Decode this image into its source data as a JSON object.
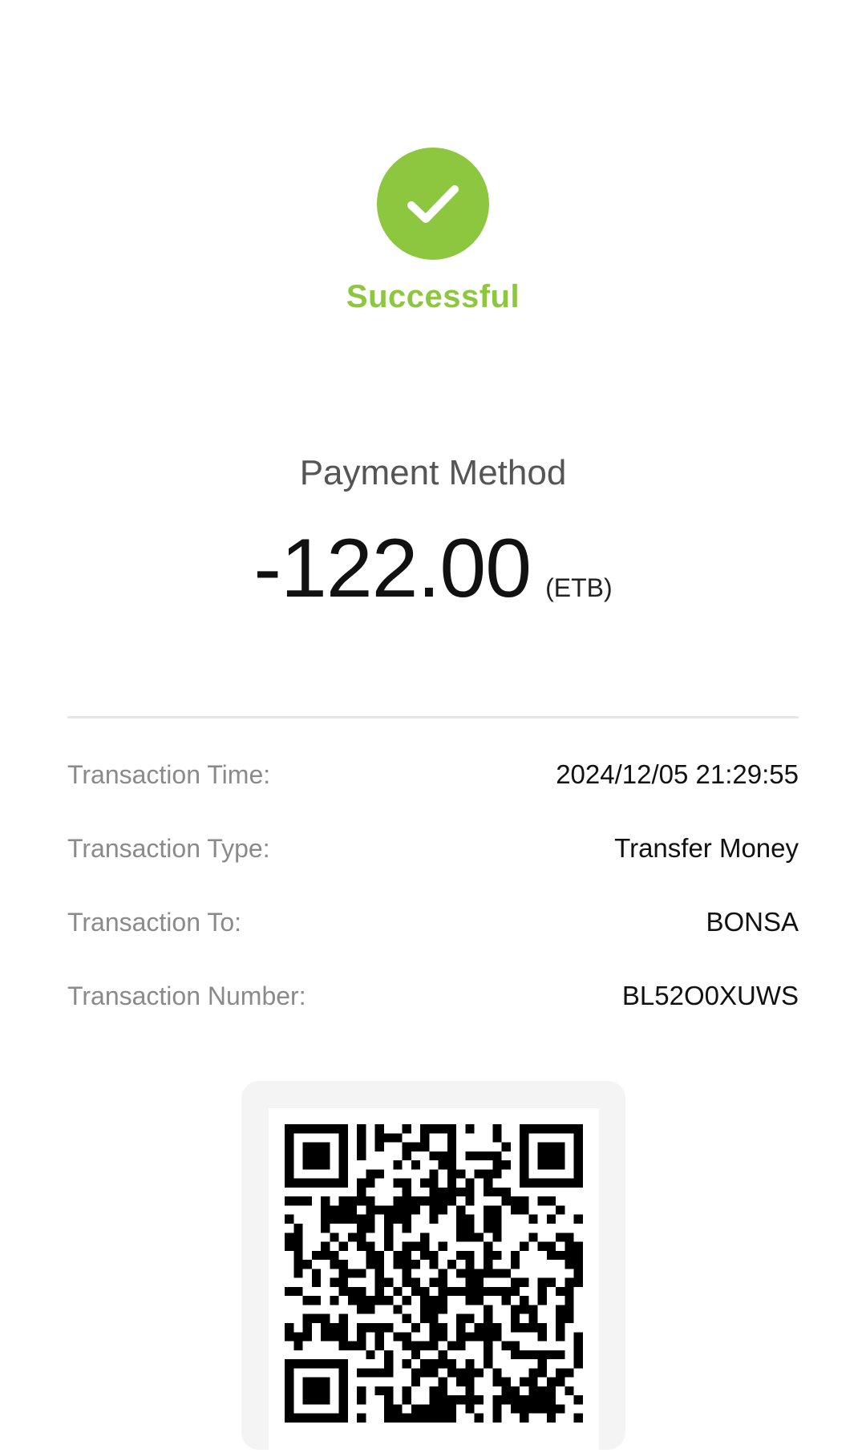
{
  "status": {
    "icon": "checkmark-icon",
    "text": "Successful",
    "color": "#8dc63f"
  },
  "payment": {
    "method_label": "Payment Method",
    "amount": "-122.00",
    "currency": "(ETB)"
  },
  "details": [
    {
      "label": "Transaction Time:",
      "value": "2024/12/05 21:29:55"
    },
    {
      "label": "Transaction Type:",
      "value": "Transfer Money"
    },
    {
      "label": "Transaction To:",
      "value": "BONSA"
    },
    {
      "label": "Transaction Number:",
      "value": "BL52O0XUWS"
    }
  ],
  "qr": {
    "icon": "qr-code-icon"
  }
}
